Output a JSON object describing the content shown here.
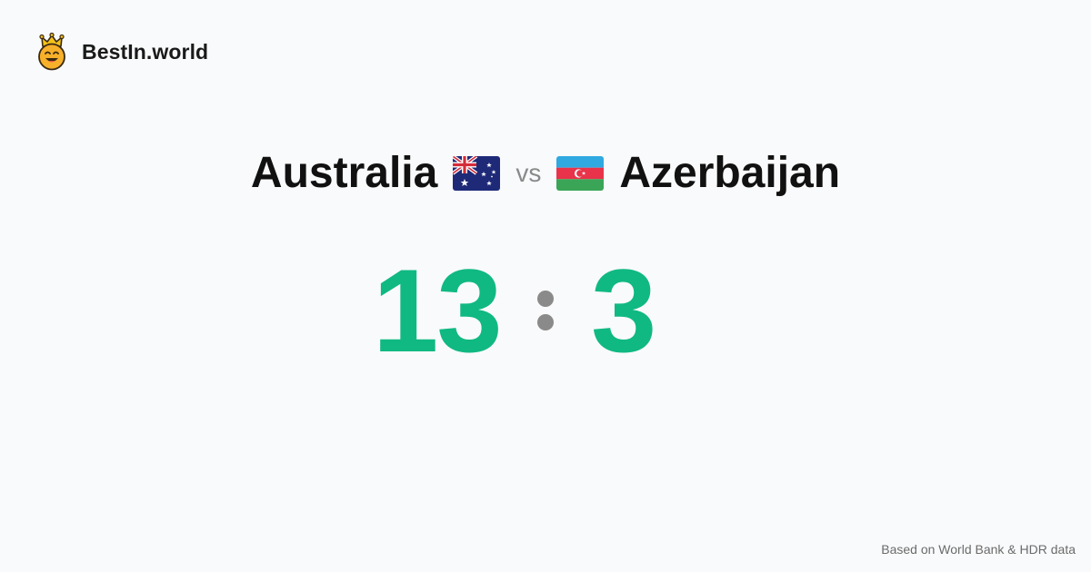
{
  "brand": {
    "name": "BestIn.world",
    "icon": "crowned-smiley-icon"
  },
  "matchup": {
    "left_country": "Australia",
    "left_flag": "australia-flag-icon",
    "vs_label": "vs",
    "right_country": "Azerbaijan",
    "right_flag": "azerbaijan-flag-icon"
  },
  "score": {
    "left": "13",
    "separator": ":",
    "right": "3"
  },
  "footer": {
    "source": "Based on World Bank & HDR data"
  },
  "colors": {
    "score": "#10b981",
    "separator": "#8a8a8a",
    "background": "#f9fafb"
  }
}
